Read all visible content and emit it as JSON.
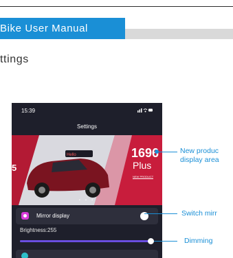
{
  "header": {
    "title": "Bike User Manual",
    "section": "ttings"
  },
  "phone": {
    "time": "15:39",
    "status_icons": "signal-wifi-battery",
    "title": "Settings",
    "banner": {
      "big_number": "1696",
      "plus": "Plus",
      "sub": "NEW PRODUCT",
      "left_char": "5"
    },
    "mirror_label": "Mirror display",
    "mirror_on": false,
    "brightness_label": "Brightness:255",
    "brightness_fraction": 1.0
  },
  "callouts": {
    "new_product_line1": "New produc",
    "new_product_line2": "display area",
    "switch_mirror": "Switch mirr",
    "dimming": "Dimming"
  },
  "colors": {
    "accent": "#1a8fd6",
    "phone_bg": "#1e1f2b",
    "slider_fill": "#6a4ee0",
    "mirror_icon": "#d83bd8",
    "banner_red": "#c81d3c"
  }
}
